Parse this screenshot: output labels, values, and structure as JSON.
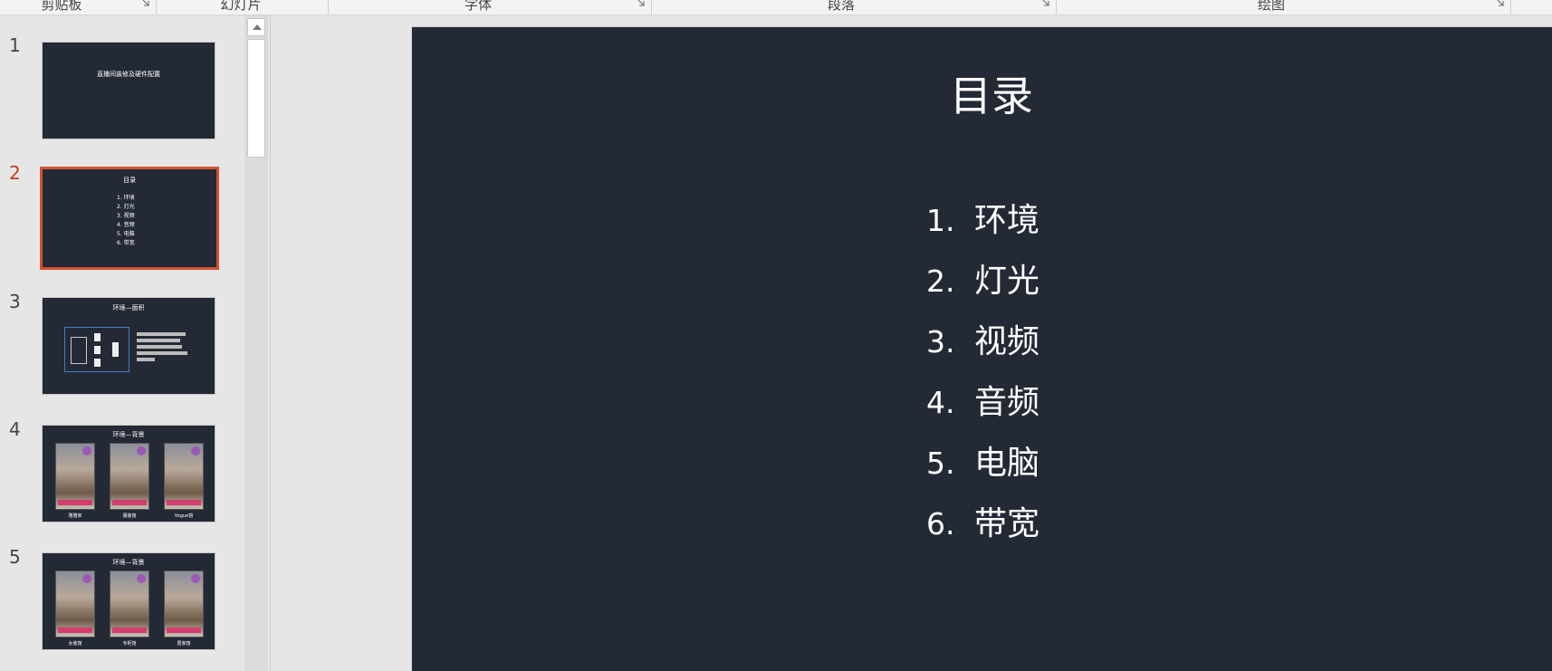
{
  "ribbon": {
    "groups": [
      "剪贴板",
      "幻灯片",
      "字体",
      "段落",
      "绘图"
    ]
  },
  "thumbnails": {
    "numbers": [
      "1",
      "2",
      "3",
      "4",
      "5"
    ],
    "slide1_title": "直播间装修及硬件配置",
    "slide2_title": "目录",
    "slide2_items": [
      "1.  环境",
      "2.  灯光",
      "3.  视频",
      "4.  音频",
      "5.  电脑",
      "6.  带宽"
    ],
    "slide3_title": "环境—面积",
    "slide4_title": "环境—背景",
    "slide4_captions": [
      "雅雅家",
      "服装馆",
      "Vogue馆"
    ],
    "slide5_title": "环境—背景",
    "slide5_captions": [
      "女装馆",
      "专柜馆",
      "居家馆"
    ]
  },
  "slide": {
    "title": "目录",
    "items": [
      {
        "num": "1.",
        "label": "环境"
      },
      {
        "num": "2.",
        "label": "灯光"
      },
      {
        "num": "3.",
        "label": "视频"
      },
      {
        "num": "4.",
        "label": "音频"
      },
      {
        "num": "5.",
        "label": "电脑"
      },
      {
        "num": "6.",
        "label": "带宽"
      }
    ]
  },
  "colors": {
    "slide_background": "#242936",
    "active_accent": "#d35230",
    "active_number": "#c43e1c"
  }
}
